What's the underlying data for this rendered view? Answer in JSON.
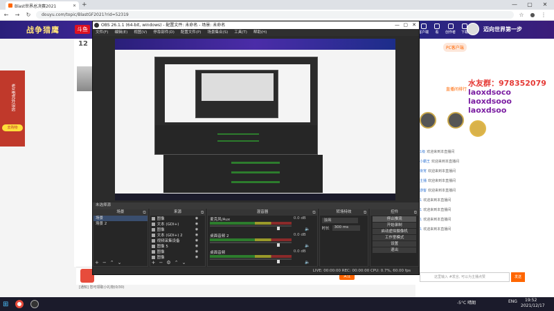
{
  "browser": {
    "tab_title": "Blast世界总决赛2021",
    "url": "douyu.com/topic/BlastGF2021?rid=52319"
  },
  "site": {
    "banner_title": "战争猎鹰",
    "banner_badge": "斗鱼",
    "banner_right": "迈向世界第一步",
    "nav_items": [
      "客户端",
      "看",
      "创作者",
      "下载"
    ],
    "badge_number": "12",
    "chat_notice": "PC客户端",
    "chat_tabs": "直播间排行",
    "side_ad_text": "老X电竞外设店",
    "side_ad_btn": "去购物",
    "overlay_lines": [
      "水友群：978352079",
      "laoxdsoco",
      "laoxdsooo",
      "laoxdsoo"
    ],
    "chat_lines": [
      {
        "name": "1级",
        "text": "欢迎来到本直播间"
      },
      {
        "name": "小霸王",
        "text": "欢迎来到本直播间"
      },
      {
        "name": "夜宵",
        "text": "欢迎来到本直播间"
      },
      {
        "name": "主播",
        "text": "欢迎来到本直播间"
      },
      {
        "name": "游客",
        "text": "欢迎来到本直播间"
      },
      {
        "name": "1",
        "text": "欢迎来到本直播间"
      },
      {
        "name": "1",
        "text": "欢迎来到本直播间"
      },
      {
        "name": "1",
        "text": "欢迎来到本直播间"
      },
      {
        "name": "1",
        "text": "欢迎来到本直播间"
      }
    ],
    "chat_placeholder": "这里输入 #发言, 可以为主播点赞",
    "send_label": "发送",
    "gift_bar_left": "[通知] 您可领取小礼物(0/30)",
    "follow_label": "关注"
  },
  "obs": {
    "title": "OBS 26.1.1 (64-bit, windows) - 配置文件: 未命名 - 场景: 未命名",
    "menu": [
      "文件(F)",
      "编辑(E)",
      "视图(V)",
      "停靠部件(D)",
      "配置文件(P)",
      "场景集合(S)",
      "工具(T)",
      "帮助(H)"
    ],
    "preview_bar": "未选择源",
    "dock_scenes_label": "场景",
    "dock_sources_label": "来源",
    "dock_mixer_label": "混音器",
    "dock_transitions_label": "转场特效",
    "dock_controls_label": "控件",
    "scenes": [
      "场景",
      "场景 2"
    ],
    "sources": [
      "图像",
      "文本 (GDI+)",
      "图像",
      "文本 (GDI+) 2",
      "视频采集设备",
      "图像 5",
      "图像",
      "图像"
    ],
    "mixer": [
      {
        "name": "麦克风/Aux",
        "db": "0.0 dB"
      },
      {
        "name": "桌面音频 2",
        "db": "0.0 dB"
      },
      {
        "name": "桌面音频",
        "db": "0.0 dB"
      }
    ],
    "transition": {
      "type": "淡出",
      "duration_label": "时长",
      "duration": "300 ms"
    },
    "controls": [
      "停止推流",
      "开始录制",
      "启动虚拟摄像机",
      "工作室模式",
      "设置",
      "退出"
    ],
    "status": "LIVE: 00:00:00    REC: 00:00:00    CPU: 0.7%, 60.00 fps"
  },
  "taskbar": {
    "weather": "-5°C 晴朗",
    "lang": "ENG",
    "time": "19:52",
    "date": "2021/12/17"
  }
}
